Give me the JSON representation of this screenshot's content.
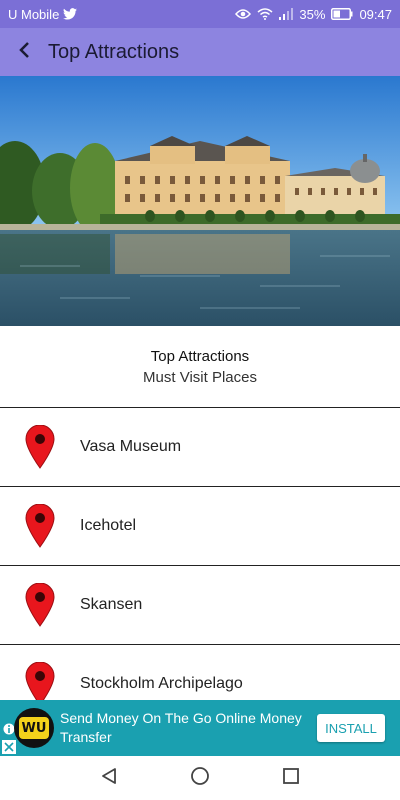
{
  "status_bar": {
    "carrier": "U Mobile",
    "battery": "35%",
    "time": "09:47",
    "icons": [
      "twitter-icon",
      "eye-icon",
      "wifi-icon",
      "signal-icon",
      "battery-icon"
    ]
  },
  "app_bar": {
    "title": "Top Attractions",
    "back_icon": "back-arrow-icon"
  },
  "hero": {
    "image": "palace-by-the-water-photo"
  },
  "intro": {
    "title": "Top Attractions",
    "subtitle": "Must Visit Places"
  },
  "attractions": [
    {
      "label": "Vasa Museum",
      "icon": "map-pin-icon"
    },
    {
      "label": "Icehotel",
      "icon": "map-pin-icon"
    },
    {
      "label": "Skansen",
      "icon": "map-pin-icon"
    },
    {
      "label": "Stockholm Archipelago",
      "icon": "map-pin-icon"
    }
  ],
  "ad": {
    "logo_text": "WU",
    "text": "Send Money On The Go Online Money Transfer",
    "install_label": "INSTALL"
  },
  "nav_bar": {
    "icons": [
      "back-triangle-icon",
      "home-circle-icon",
      "recents-square-icon"
    ]
  },
  "colors": {
    "status_bar": "#7b6fd6",
    "app_bar": "#8d84e0",
    "pin": "#e8161d",
    "ad_background": "#1aa0b0"
  }
}
